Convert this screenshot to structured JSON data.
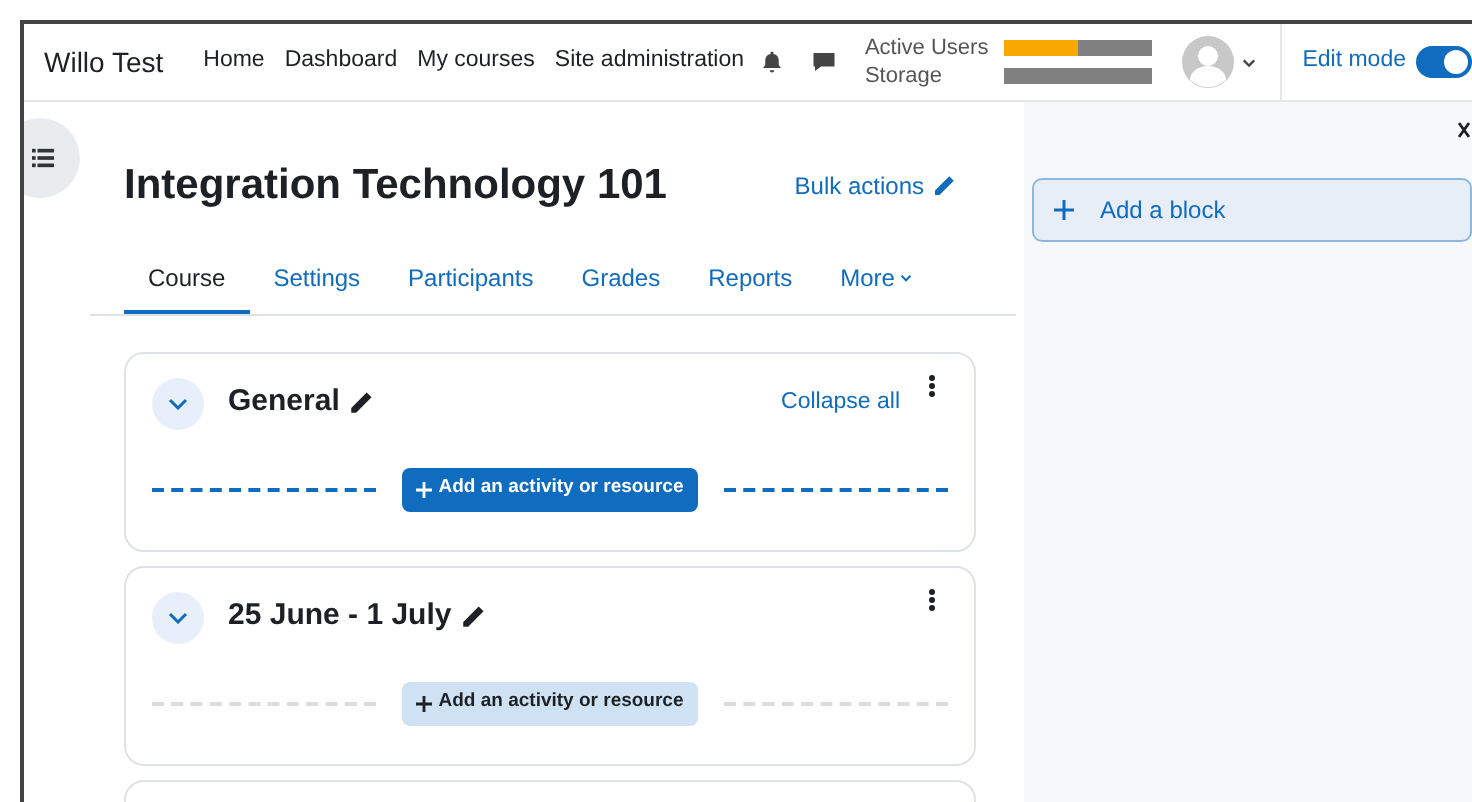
{
  "navbar": {
    "site_name": "Willo Test",
    "links": [
      "Home",
      "Dashboard",
      "My courses",
      "Site administration"
    ],
    "meters": [
      {
        "label": "Active Users",
        "level": 0.5
      },
      {
        "label": "Storage",
        "level": 0
      }
    ],
    "edit_mode": {
      "label": "Edit mode",
      "on": true
    }
  },
  "course": {
    "title": "Integration Technology 101",
    "bulk_actions": "Bulk actions",
    "tabs": [
      {
        "label": "Course",
        "selected": true
      },
      {
        "label": "Settings",
        "selected": false
      },
      {
        "label": "Participants",
        "selected": false
      },
      {
        "label": "Grades",
        "selected": false
      },
      {
        "label": "Reports",
        "selected": false
      },
      {
        "label": "More",
        "selected": false
      }
    ],
    "collapse_all": "Collapse all",
    "sections": [
      {
        "title": "General",
        "highlighted": true,
        "add_button": "Add an activity or resource"
      },
      {
        "title": "25 June - 1 July",
        "highlighted": false,
        "add_button": "Add an activity or resource"
      }
    ]
  },
  "block_drawer": {
    "add_block": "Add a block"
  }
}
